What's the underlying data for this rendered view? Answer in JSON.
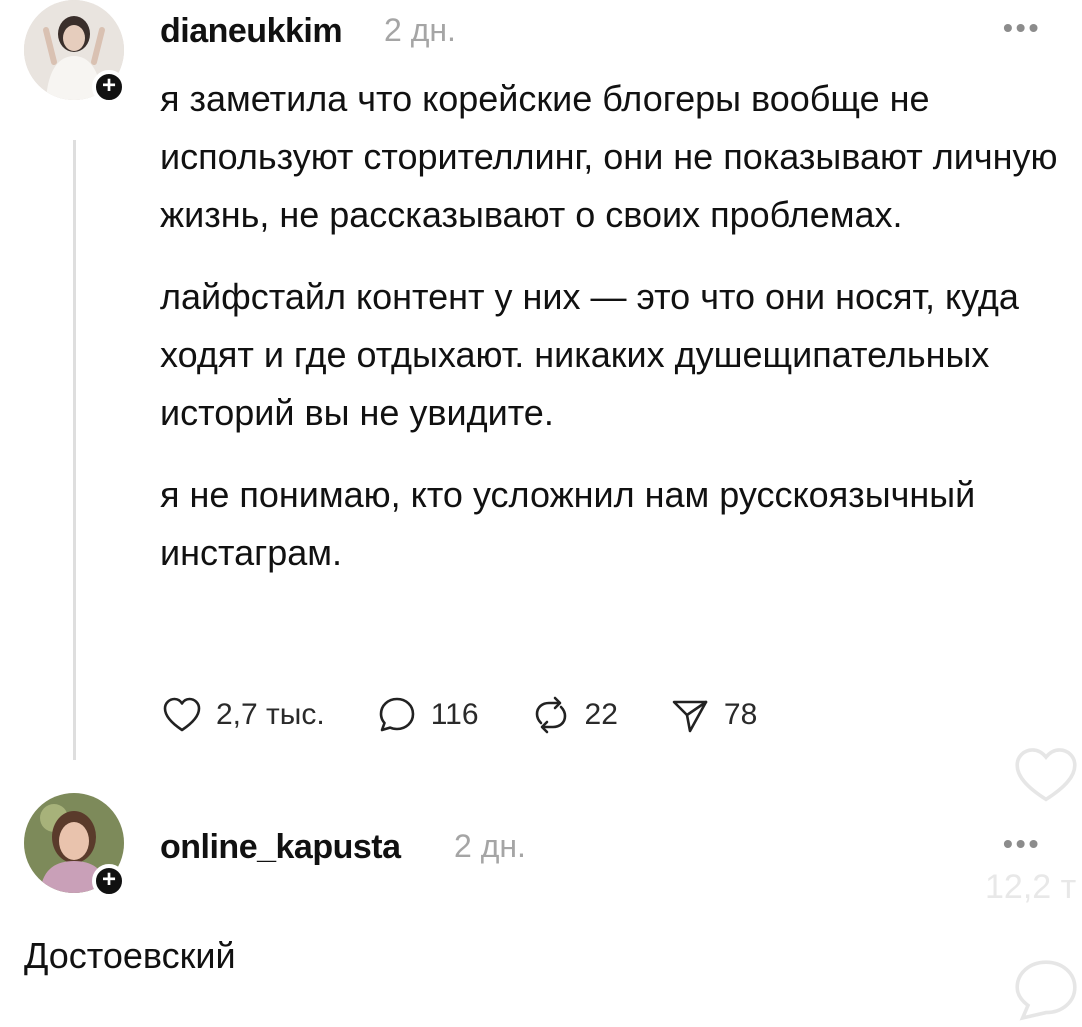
{
  "post": {
    "username": "dianeukkim",
    "time": "2 дн.",
    "more": "•••",
    "paragraphs": [
      "я заметила что корейские блогеры вообще не используют сторителлинг, они не показывают личную жизнь, не рассказывают о своих проблемах.",
      "лайфстайл контент у них — это что они носят, куда ходят и где отдыхают. никаких душещипательных историй вы не увидите.",
      "я не понимаю, кто усложнил нам русскоязычный инстаграм."
    ],
    "actions": {
      "likes": "2,7 тыс.",
      "replies": "116",
      "reposts": "22",
      "shares": "78"
    },
    "icons": [
      "heart-icon",
      "comment-icon",
      "repost-icon",
      "share-icon"
    ]
  },
  "reply": {
    "username": "online_kapusta",
    "time": "2 дн.",
    "more": "•••",
    "text": "Достоевский"
  },
  "overlay": {
    "count_fragment": "12,2 т"
  },
  "colors": {
    "text": "#111111",
    "muted": "#a5a5a5",
    "thread_line": "#dedede",
    "background": "#ffffff"
  }
}
